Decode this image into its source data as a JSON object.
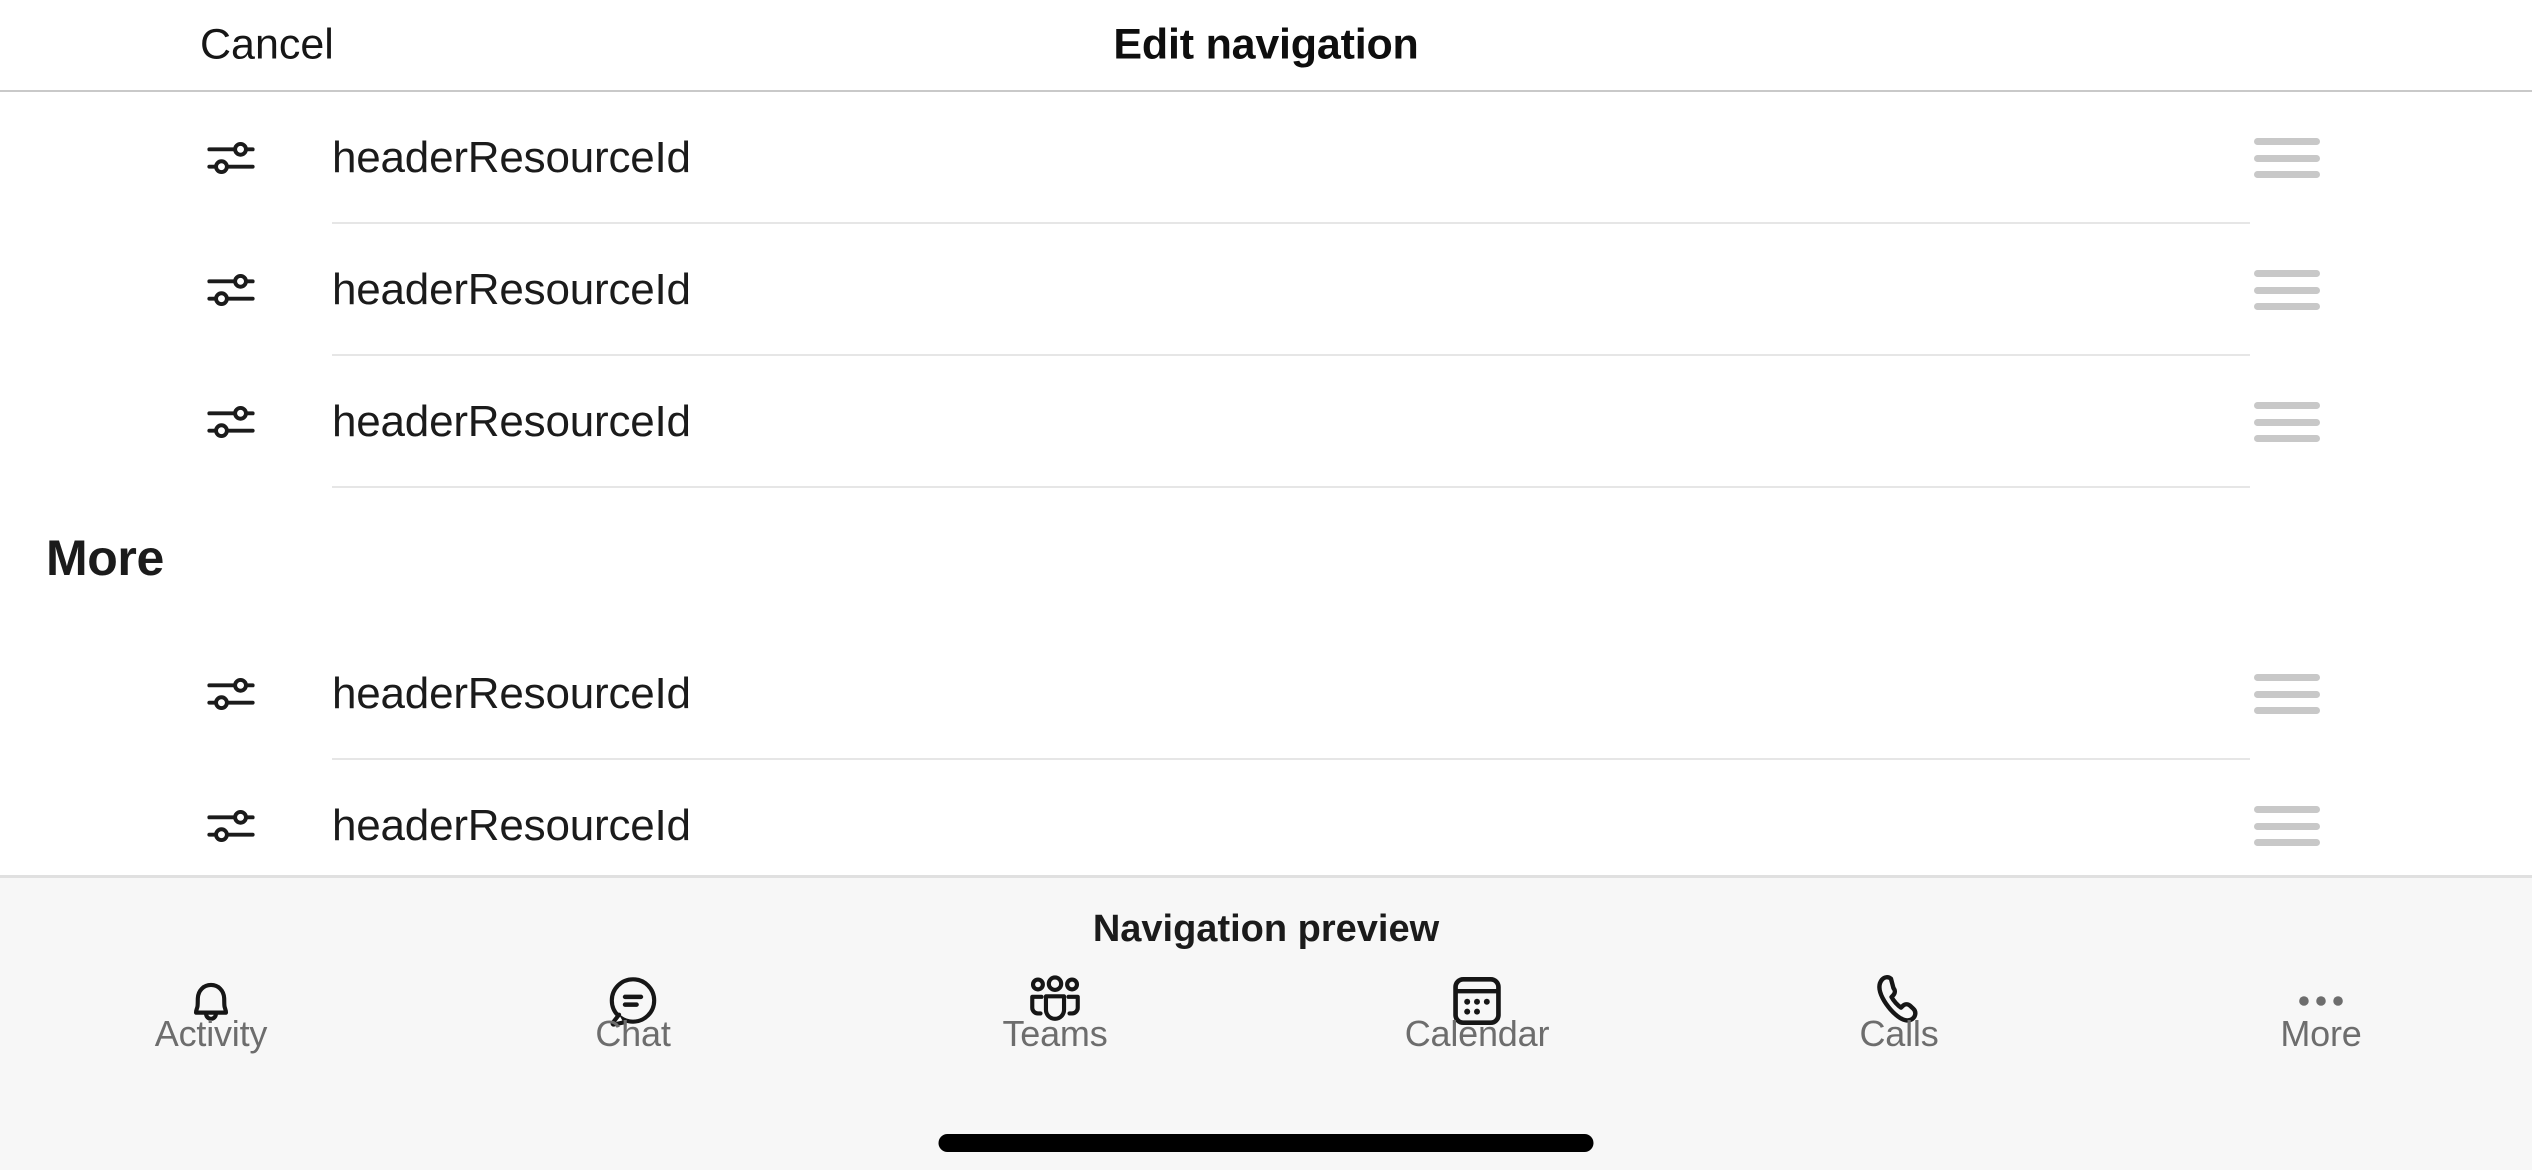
{
  "header": {
    "cancel_label": "Cancel",
    "title": "Edit navigation"
  },
  "list": {
    "pinned_rows": [
      {
        "label": "headerResourceId",
        "icon": "sliders-icon",
        "handle": "drag-handle-icon"
      },
      {
        "label": "headerResourceId",
        "icon": "sliders-icon",
        "handle": "drag-handle-icon"
      },
      {
        "label": "headerResourceId",
        "icon": "sliders-icon",
        "handle": "drag-handle-icon"
      }
    ],
    "more_section_title": "More",
    "more_rows": [
      {
        "label": "headerResourceId",
        "icon": "sliders-icon",
        "handle": "drag-handle-icon"
      },
      {
        "label": "headerResourceId",
        "icon": "sliders-icon",
        "handle": "drag-handle-icon"
      }
    ]
  },
  "preview": {
    "title": "Navigation preview",
    "tabs": [
      {
        "label": "Activity",
        "icon": "bell-icon"
      },
      {
        "label": "Chat",
        "icon": "chat-bubble-icon"
      },
      {
        "label": "Teams",
        "icon": "people-group-icon"
      },
      {
        "label": "Calendar",
        "icon": "calendar-icon"
      },
      {
        "label": "Calls",
        "icon": "phone-icon"
      },
      {
        "label": "More",
        "icon": "ellipsis-icon"
      }
    ]
  },
  "colors": {
    "background": "#ffffff",
    "preview_background": "#f7f7f7",
    "divider": "#e6e6e6",
    "handle": "#c8c8c8",
    "text_primary": "#1b1b1b",
    "text_secondary": "#6d6d6d"
  }
}
